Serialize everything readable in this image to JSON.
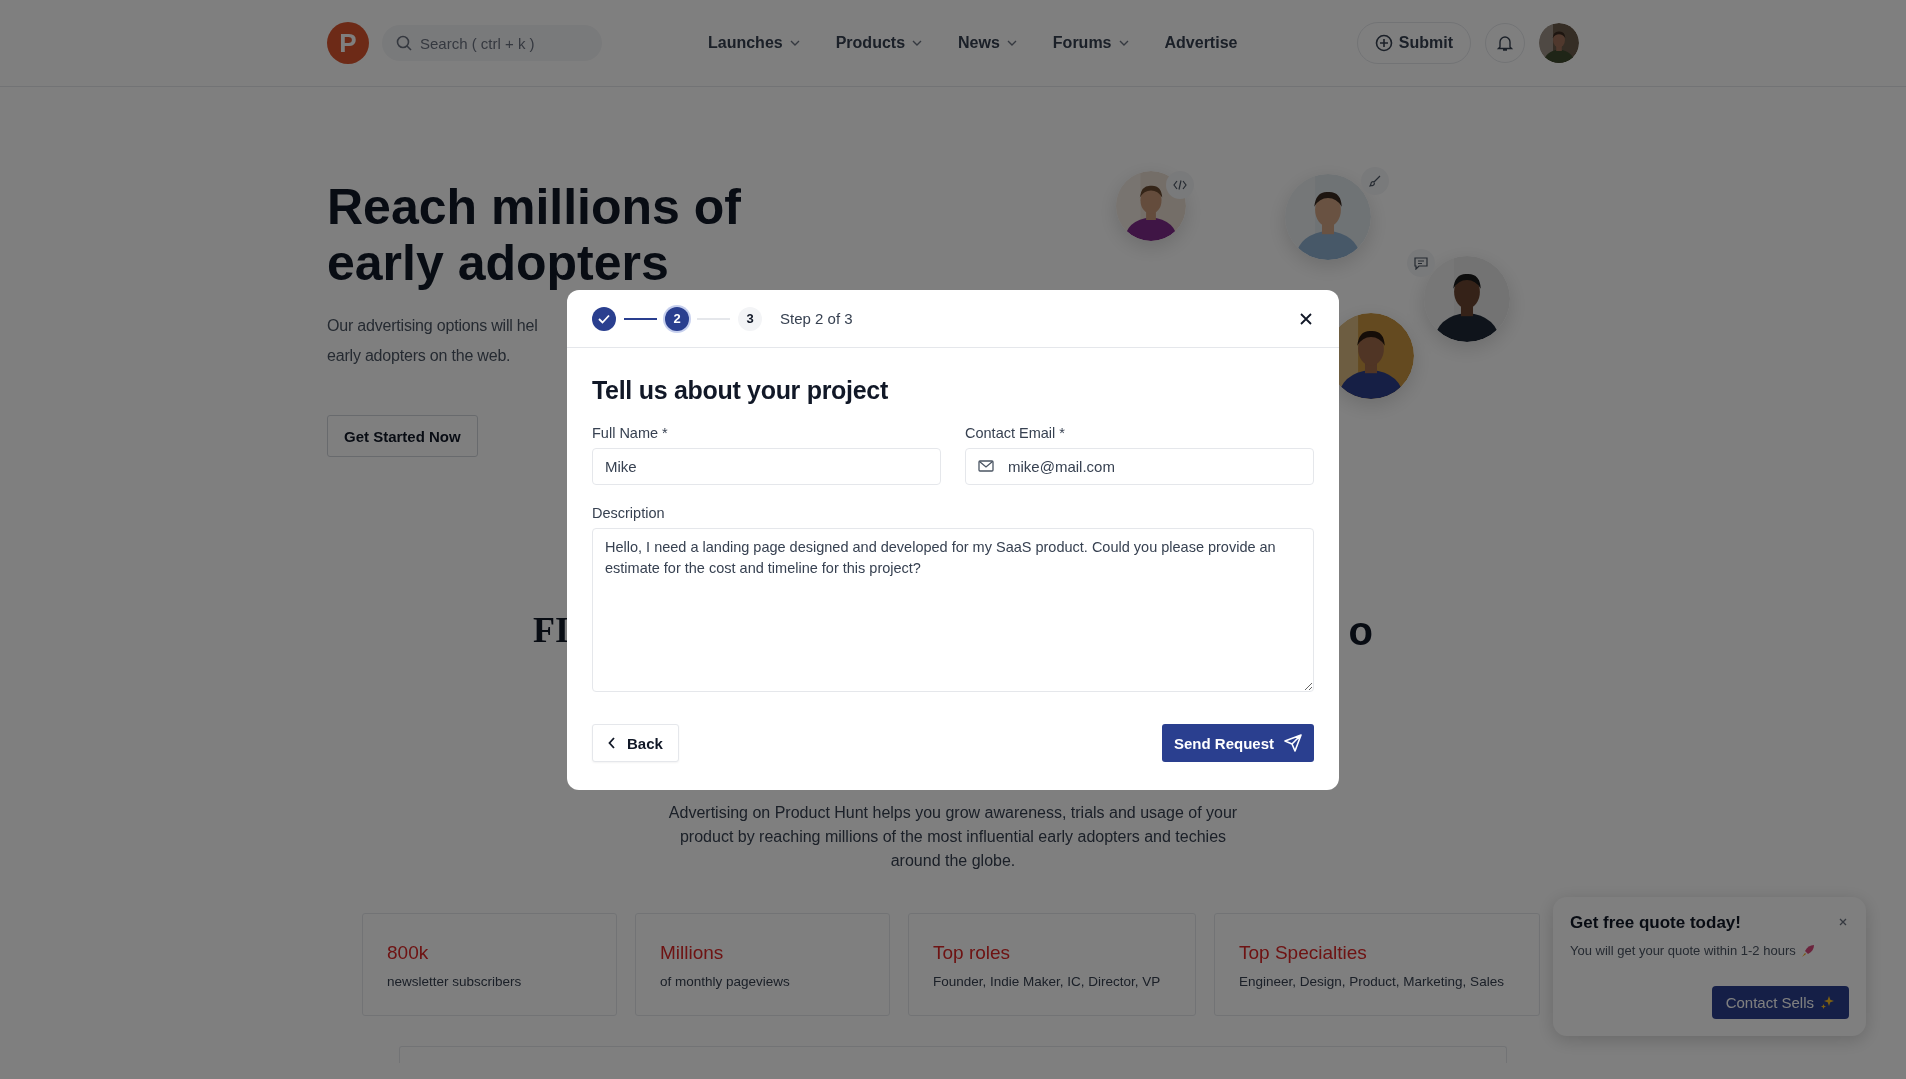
{
  "header": {
    "logo": "P",
    "search": {
      "placeholder": "Search ( ctrl + k )"
    },
    "nav": [
      {
        "label": "Launches",
        "has_menu": true
      },
      {
        "label": "Products",
        "has_menu": true
      },
      {
        "label": "News",
        "has_menu": true
      },
      {
        "label": "Forums",
        "has_menu": true
      },
      {
        "label": "Advertise",
        "has_menu": false
      }
    ],
    "submit": "Submit"
  },
  "hero": {
    "title": "Reach millions of early adopters",
    "subtitle_lines": [
      "Our advertising options will hel",
      "early adopters on the web."
    ],
    "cta": "Get Started Now"
  },
  "section_heading": {
    "left": "FI",
    "right": "o"
  },
  "intro": "Advertising on Product Hunt helps you grow awareness, trials and usage of your product by reaching millions of the most influential early adopters and techies around the globe.",
  "stats": [
    {
      "value": "800k",
      "caption": "newsletter subscribers"
    },
    {
      "value": "Millions",
      "caption": "of monthly pageviews"
    },
    {
      "value": "Top roles",
      "caption": "Founder, Indie Maker, IC, Director, VP"
    },
    {
      "value": "Top Specialties",
      "caption": "Engineer, Design, Product, Marketing, Sales"
    }
  ],
  "quote": {
    "title": "Get free quote today!",
    "text": "You will get your quote within 1-2 hours",
    "button": "Contact Sells"
  },
  "modal": {
    "steps": [
      {
        "done": true,
        "selected": false
      },
      {
        "number": "2",
        "done": false,
        "selected": true
      },
      {
        "number": "3",
        "done": false,
        "selected": false
      }
    ],
    "step_text": "Step 2 of 3",
    "title": "Tell us about your project",
    "fields": [
      {
        "label": "Full Name *",
        "value": "Mike",
        "kind": "text"
      },
      {
        "label": "Contact Email *",
        "value": "mike@mail.com",
        "kind": "email"
      }
    ],
    "description": {
      "label": "Description",
      "value": "Hello, I need a landing page designed and developed for my SaaS product. Could you please provide an estimate for the cost and timeline for this project?"
    },
    "back": "Back",
    "send": "Send Request"
  }
}
